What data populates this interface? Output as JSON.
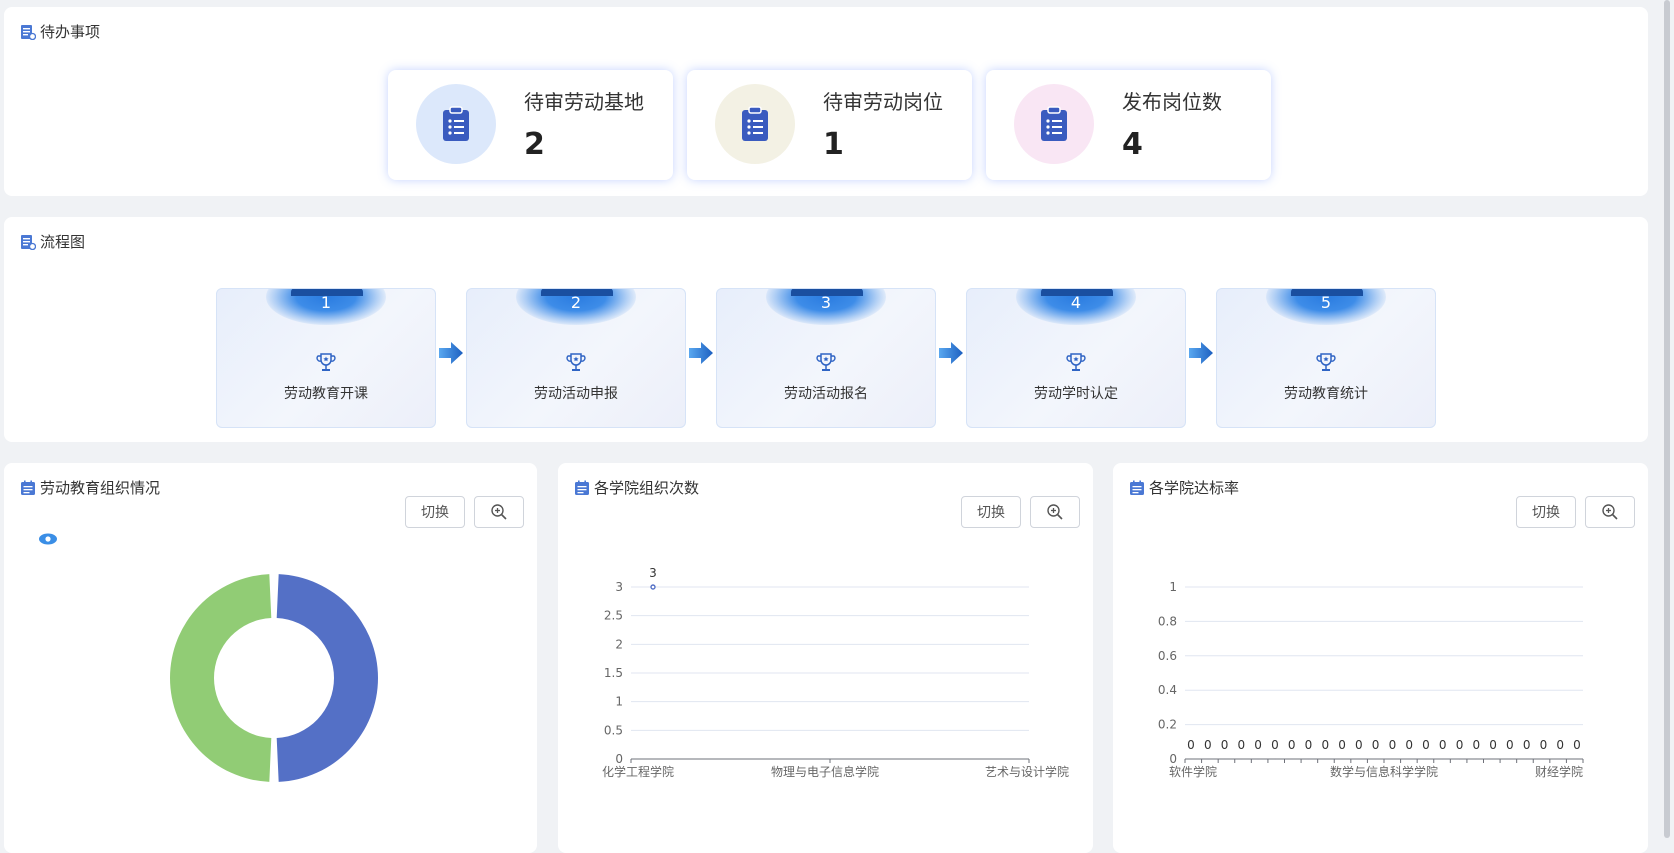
{
  "pending": {
    "title": "待办事项",
    "cards": [
      {
        "label": "待审劳动基地",
        "value": "2",
        "circle_color": "#dce8fb"
      },
      {
        "label": "待审劳动岗位",
        "value": "1",
        "circle_color": "#f3f1e4"
      },
      {
        "label": "发布岗位数",
        "value": "4",
        "circle_color": "#f9e6f4"
      }
    ]
  },
  "flow": {
    "title": "流程图",
    "steps": [
      {
        "num": "1",
        "label": "劳动教育开课"
      },
      {
        "num": "2",
        "label": "劳动活动申报"
      },
      {
        "num": "3",
        "label": "劳动活动报名"
      },
      {
        "num": "4",
        "label": "劳动学时认定"
      },
      {
        "num": "5",
        "label": "劳动教育统计"
      }
    ]
  },
  "buttons": {
    "switch_label": "切换"
  },
  "colors": {
    "accent": "#4a78d4",
    "donut_blue": "#5470c6",
    "donut_green": "#91cc75",
    "icon_blue": "#3a5bbf"
  },
  "chart_data": [
    {
      "type": "pie",
      "title": "劳动教育组织情况",
      "donut": true,
      "slices": [
        {
          "value": 50,
          "color": "#5470c6"
        },
        {
          "value": 50,
          "color": "#91cc75"
        }
      ]
    },
    {
      "type": "line",
      "title": "各学院组织次数",
      "categories": [
        "化学工程学院",
        "物理与电子信息学院",
        "艺术与设计学院"
      ],
      "y_ticks": [
        "0",
        "0.5",
        "1",
        "1.5",
        "2",
        "2.5",
        "3"
      ],
      "ylim": [
        0,
        3
      ],
      "series": [
        {
          "values": [
            3
          ],
          "labels": [
            "3"
          ]
        }
      ]
    },
    {
      "type": "line",
      "title": "各学院达标率",
      "categories": [
        "软件学院",
        "数学与信息科学学院",
        "财经学院"
      ],
      "y_ticks": [
        "0",
        "0.2",
        "0.4",
        "0.6",
        "0.8",
        "1"
      ],
      "ylim": [
        0,
        1
      ],
      "point_count": 24,
      "series": [
        {
          "values": [
            0,
            0,
            0,
            0,
            0,
            0,
            0,
            0,
            0,
            0,
            0,
            0,
            0,
            0,
            0,
            0,
            0,
            0,
            0,
            0,
            0,
            0,
            0,
            0
          ],
          "label": "0"
        }
      ]
    }
  ]
}
